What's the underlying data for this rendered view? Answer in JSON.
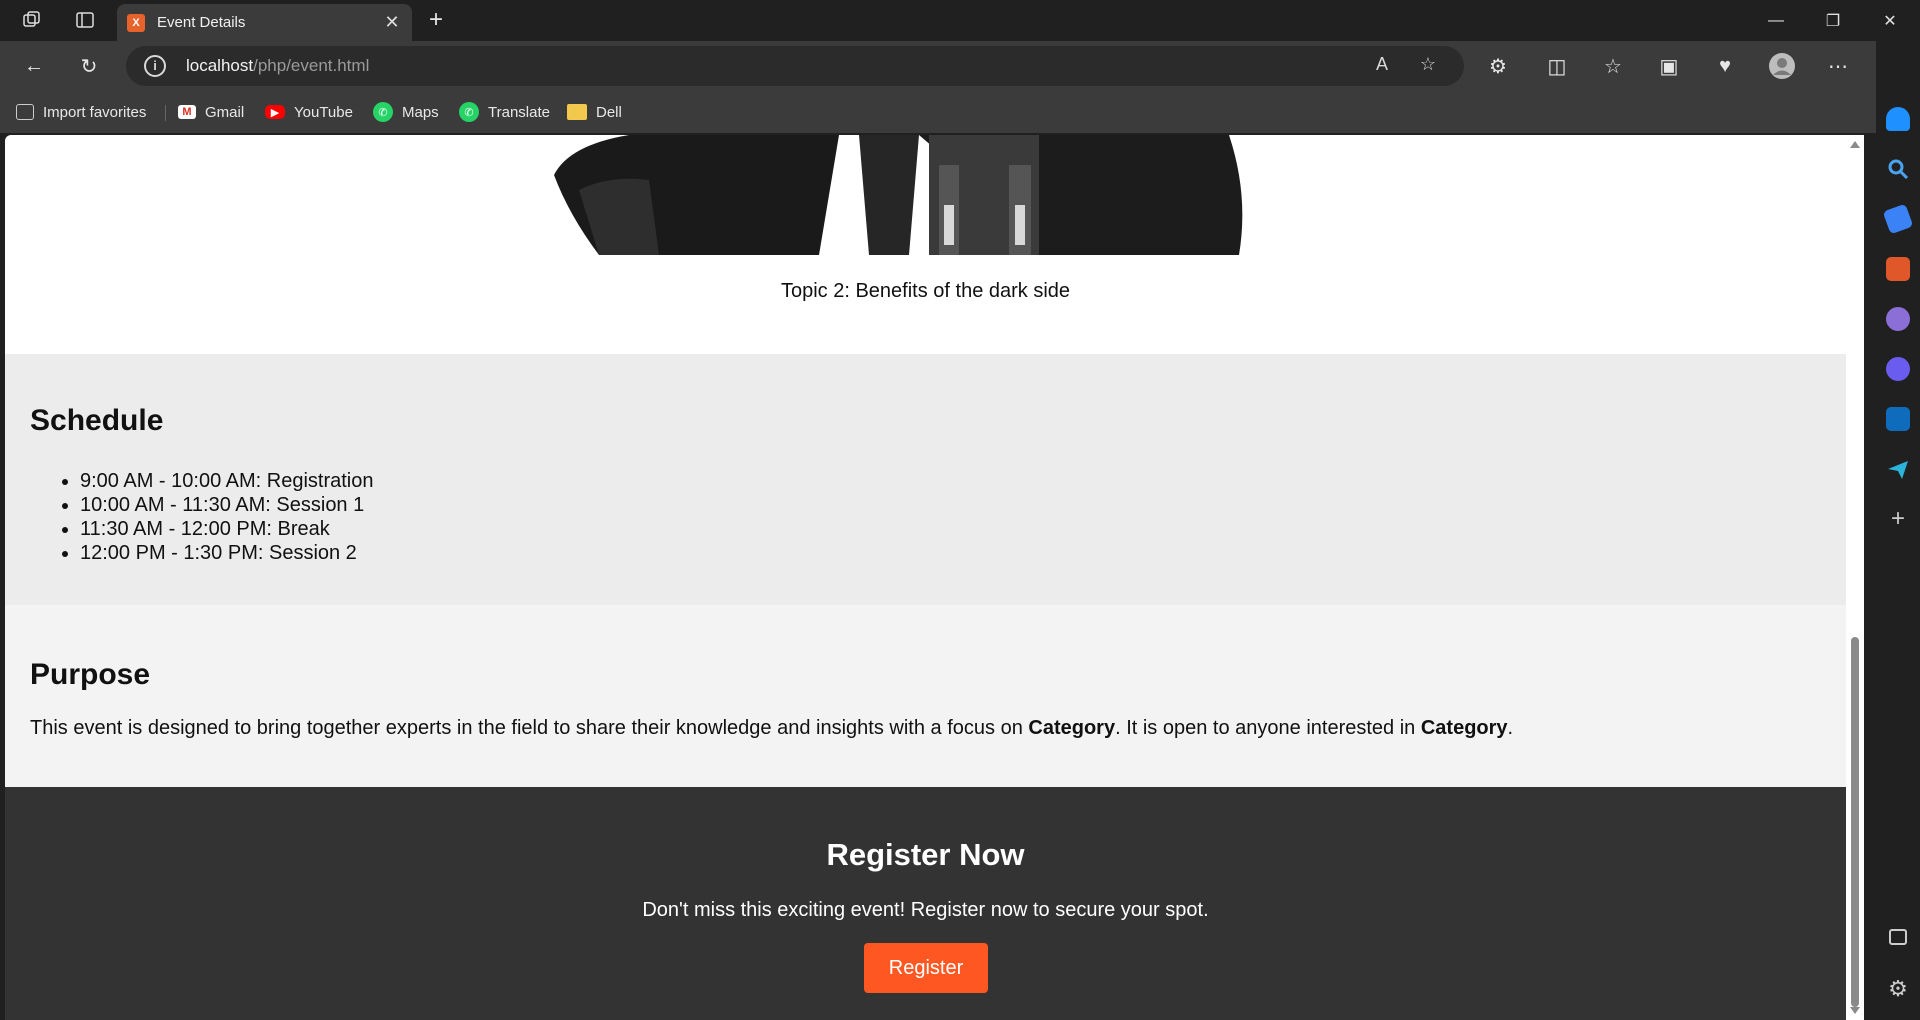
{
  "browser": {
    "tab_title": "Event Details",
    "url_host": "localhost",
    "url_path": "/php/event.html",
    "bookmarks": [
      {
        "label": "Import favorites"
      },
      {
        "label": "Gmail"
      },
      {
        "label": "YouTube"
      },
      {
        "label": "Maps"
      },
      {
        "label": "Translate"
      },
      {
        "label": "Dell"
      }
    ]
  },
  "page": {
    "topic_caption": "Topic 2: Benefits of the dark side",
    "schedule": {
      "heading": "Schedule",
      "items": [
        "9:00 AM - 10:00 AM: Registration",
        "10:00 AM - 11:30 AM: Session 1",
        "11:30 AM - 12:00 PM: Break",
        "12:00 PM - 1:30 PM: Session 2"
      ]
    },
    "purpose": {
      "heading": "Purpose",
      "text_1": "This event is designed to bring together experts in the field to share their knowledge and insights with a focus on ",
      "bold_1": "Category",
      "text_2": ". It is open to anyone interested in ",
      "bold_2": "Category",
      "text_3": "."
    },
    "register": {
      "heading": "Register Now",
      "text": "Don't miss this exciting event! Register now to secure your spot.",
      "button_label": "Register"
    }
  },
  "colors": {
    "accent_button": "#ff5722",
    "register_bg": "#333333",
    "schedule_bg": "#ececec",
    "purpose_bg": "#f3f3f3"
  }
}
